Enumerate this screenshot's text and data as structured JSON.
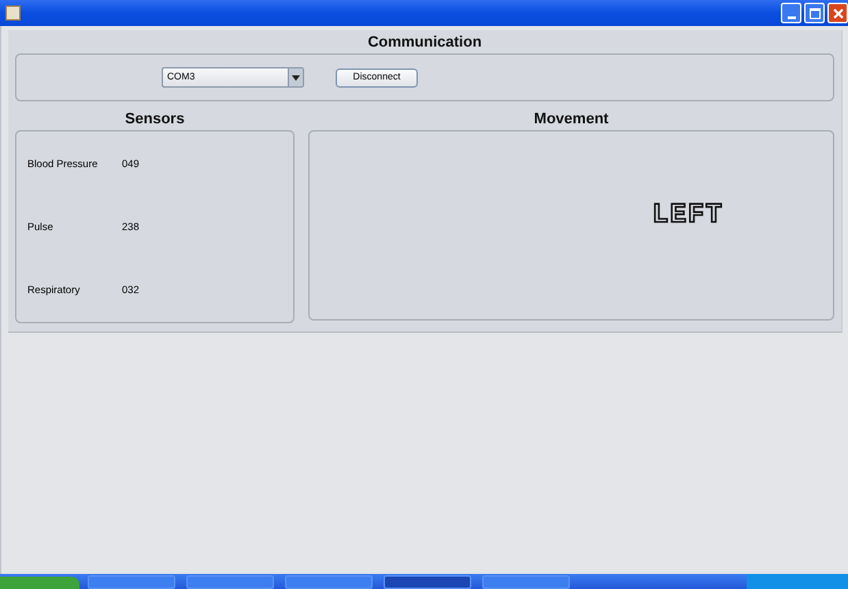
{
  "communication": {
    "title": "Communication",
    "port": "COM3",
    "button": "Disconnect"
  },
  "sensors": {
    "title": "Sensors",
    "rows": [
      {
        "label": "Blood Pressure",
        "value": "049"
      },
      {
        "label": "Pulse",
        "value": "238"
      },
      {
        "label": "Respiratory",
        "value": "032"
      }
    ]
  },
  "movement": {
    "title": "Movement",
    "direction": "LEFT"
  },
  "taskbar": {
    "items": [
      {
        "selected": false
      },
      {
        "selected": false
      },
      {
        "selected": false
      },
      {
        "selected": true
      },
      {
        "selected": false
      }
    ]
  }
}
